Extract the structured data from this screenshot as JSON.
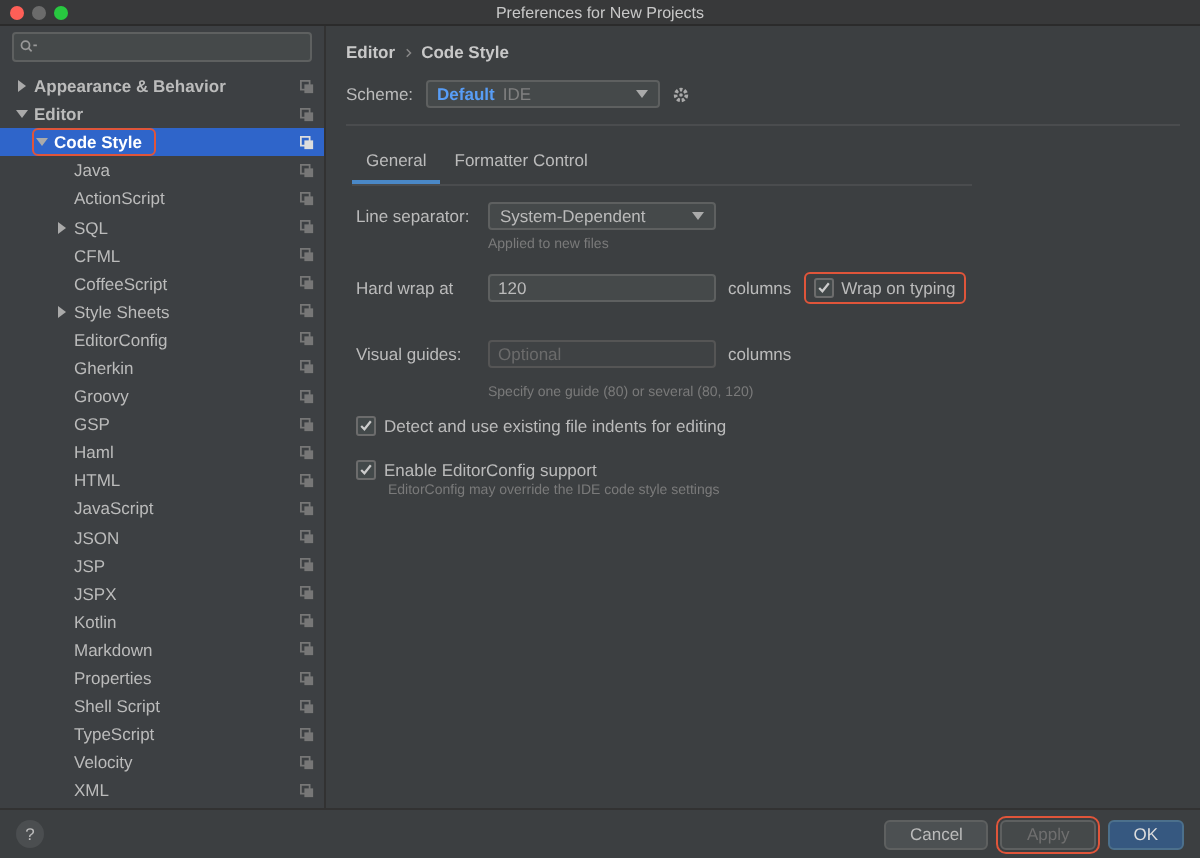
{
  "window": {
    "title": "Preferences for New Projects"
  },
  "tree": [
    {
      "label": "Appearance & Behavior",
      "expanded": false,
      "selected": false
    },
    {
      "label": "Editor",
      "expanded": true,
      "selected": false,
      "children": [
        {
          "label": "Code Style",
          "expanded": true,
          "selected": true,
          "highlighted": true,
          "children": [
            {
              "label": "Java",
              "selected": false
            },
            {
              "label": "ActionScript",
              "selected": false
            },
            {
              "label": "SQL",
              "expanded": false,
              "selected": false
            },
            {
              "label": "CFML",
              "selected": false
            },
            {
              "label": "CoffeeScript",
              "selected": false
            },
            {
              "label": "Style Sheets",
              "expanded": false,
              "selected": false
            },
            {
              "label": "EditorConfig",
              "selected": false
            },
            {
              "label": "Gherkin",
              "selected": false
            },
            {
              "label": "Groovy",
              "selected": false
            },
            {
              "label": "GSP",
              "selected": false
            },
            {
              "label": "Haml",
              "selected": false
            },
            {
              "label": "HTML",
              "selected": false
            },
            {
              "label": "JavaScript",
              "selected": false
            },
            {
              "label": "JSON",
              "selected": false
            },
            {
              "label": "JSP",
              "selected": false
            },
            {
              "label": "JSPX",
              "selected": false
            },
            {
              "label": "Kotlin",
              "selected": false
            },
            {
              "label": "Markdown",
              "selected": false
            },
            {
              "label": "Properties",
              "selected": false
            },
            {
              "label": "Shell Script",
              "selected": false
            },
            {
              "label": "TypeScript",
              "selected": false
            },
            {
              "label": "Velocity",
              "selected": false
            },
            {
              "label": "XML",
              "selected": false
            }
          ]
        }
      ]
    }
  ],
  "breadcrumb": [
    "Editor",
    "Code Style"
  ],
  "scheme": {
    "label": "Scheme:",
    "name": "Default",
    "type": "IDE"
  },
  "tabs": [
    {
      "label": "General",
      "selected": true
    },
    {
      "label": "Formatter Control",
      "selected": false
    }
  ],
  "line_separator": {
    "label": "Line separator:",
    "value": "System-Dependent",
    "hint": "Applied to new files"
  },
  "hard_wrap": {
    "label": "Hard wrap at",
    "value": "120",
    "unit": "columns",
    "wrap_on_typing": {
      "label": "Wrap on typing",
      "checked": true,
      "highlighted": true
    }
  },
  "visual_guides": {
    "label": "Visual guides:",
    "placeholder": "Optional",
    "unit": "columns",
    "hint": "Specify one guide (80) or several (80, 120)"
  },
  "options": [
    {
      "label": "Detect and use existing file indents for editing",
      "checked": true
    },
    {
      "label": "Enable EditorConfig support",
      "checked": true,
      "hint": "EditorConfig may override the IDE code style settings"
    }
  ],
  "help_button": "?",
  "buttons": [
    {
      "label": "Cancel",
      "kind": "normal",
      "disabled": false,
      "highlighted": false
    },
    {
      "label": "Apply",
      "kind": "normal",
      "disabled": true,
      "highlighted": true
    },
    {
      "label": "OK",
      "kind": "default",
      "disabled": false,
      "highlighted": false
    }
  ]
}
